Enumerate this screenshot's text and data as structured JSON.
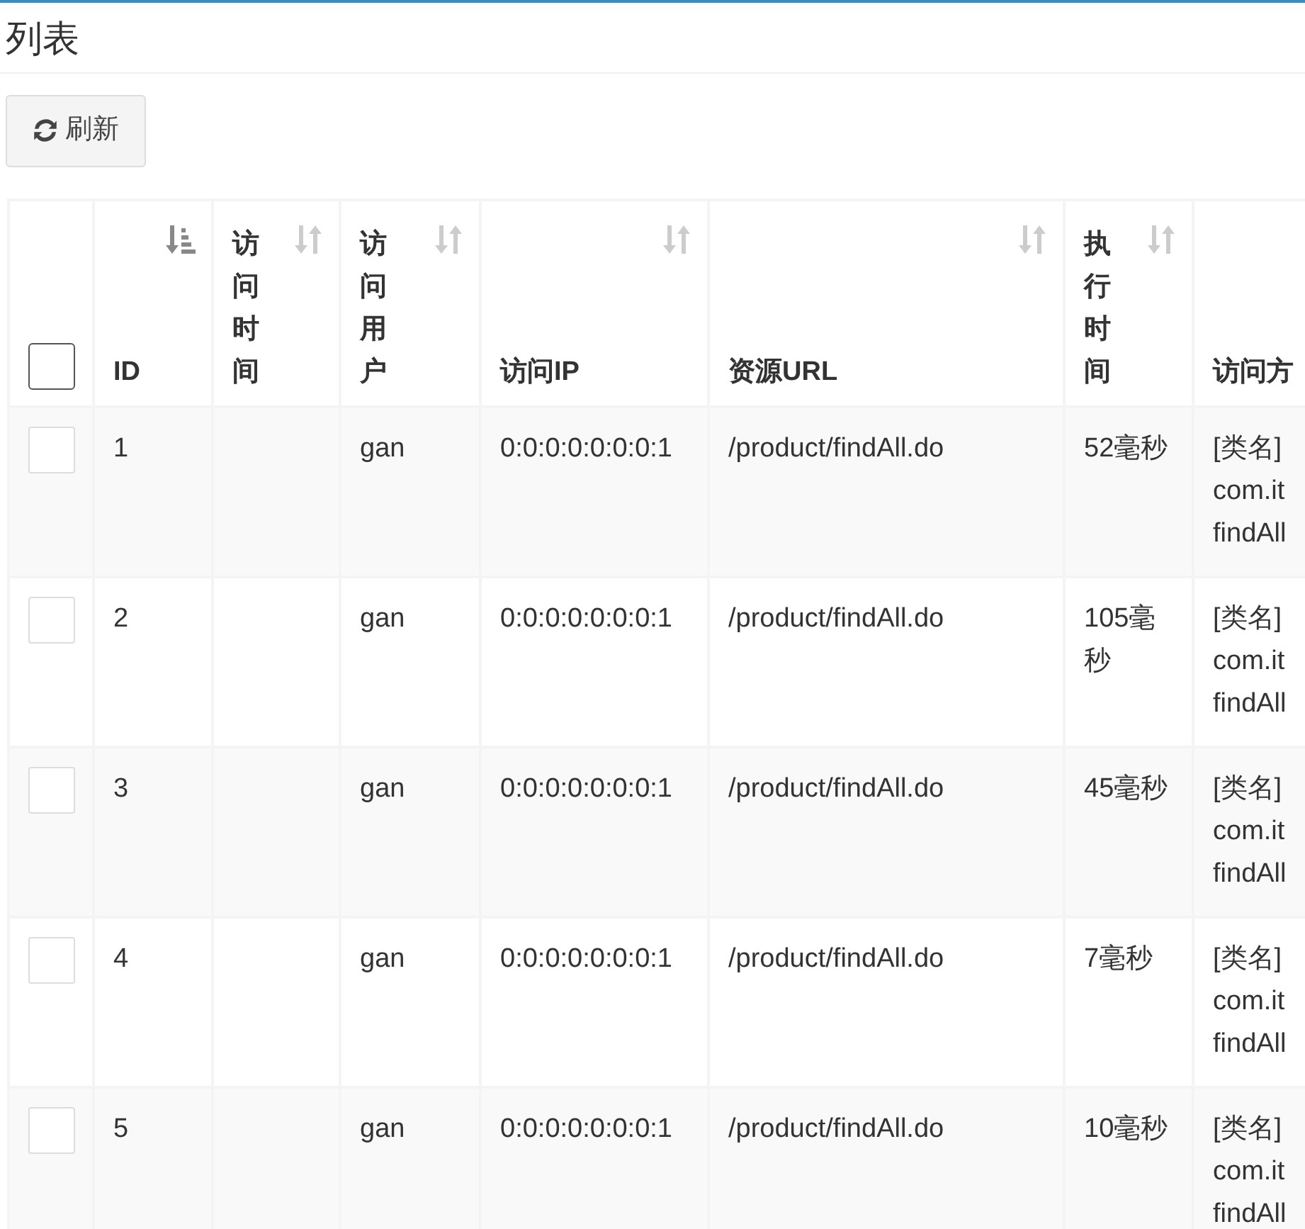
{
  "title": "列表",
  "toolbar": {
    "refresh_button": "刷新"
  },
  "table": {
    "select_all": {
      "checked": false
    },
    "columns": [
      {
        "label": "ID",
        "sorted": true
      },
      {
        "label": "访问时间",
        "sorted": false
      },
      {
        "label": "访问用户",
        "sorted": false
      },
      {
        "label": "访问IP",
        "sorted": false
      },
      {
        "label": "资源URL",
        "sorted": false
      },
      {
        "label": "执行时间",
        "sorted": false
      },
      {
        "label": "访问方"
      }
    ],
    "rows": [
      {
        "checked": false,
        "cells": [
          "1",
          "",
          "gan",
          "0:0:0:0:0:0:0:1",
          "/product/findAll.do",
          "52毫秒",
          [
            "[类名]",
            "com.it",
            "findAll"
          ]
        ]
      },
      {
        "checked": false,
        "cells": [
          "2",
          "",
          "gan",
          "0:0:0:0:0:0:0:1",
          "/product/findAll.do",
          "105毫秒",
          [
            "[类名]",
            "com.it",
            "findAll"
          ]
        ]
      },
      {
        "checked": false,
        "cells": [
          "3",
          "",
          "gan",
          "0:0:0:0:0:0:0:1",
          "/product/findAll.do",
          "45毫秒",
          [
            "[类名]",
            "com.it",
            "findAll"
          ]
        ]
      },
      {
        "checked": false,
        "cells": [
          "4",
          "",
          "gan",
          "0:0:0:0:0:0:0:1",
          "/product/findAll.do",
          "7毫秒",
          [
            "[类名]",
            "com.it",
            "findAll"
          ]
        ]
      },
      {
        "checked": false,
        "cells": [
          "5",
          "",
          "gan",
          "0:0:0:0:0:0:0:1",
          "/product/findAll.do",
          "10毫秒",
          [
            "[类名]",
            "com.it",
            "findAll"
          ]
        ]
      }
    ]
  }
}
